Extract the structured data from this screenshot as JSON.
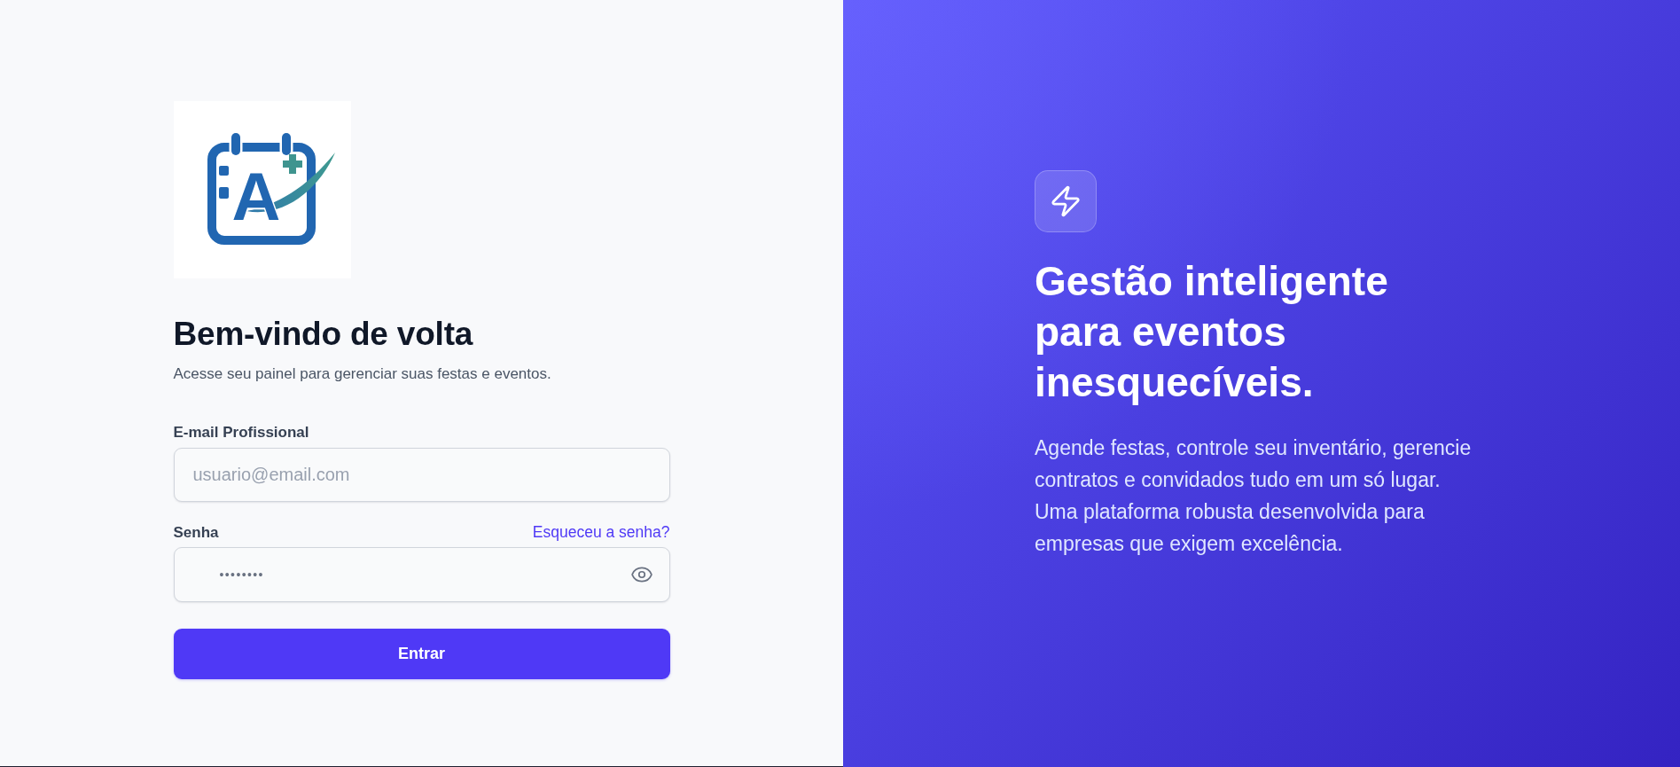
{
  "logo": {
    "letter": "A"
  },
  "login": {
    "heading": "Bem-vindo de volta",
    "subtitle": "Acesse seu painel para gerenciar suas festas e eventos.",
    "email": {
      "label": "E-mail Profissional",
      "placeholder": "usuario@email.com"
    },
    "password": {
      "label": "Senha",
      "forgot_link": "Esqueceu a senha?",
      "value": "••••••••"
    },
    "submit_button": "Entrar"
  },
  "hero": {
    "heading": "Gestão inteligente para eventos inesquecíveis.",
    "description": "Agende festas, controle seu inventário, gerencie contratos e convidados tudo em um só lugar. Uma plataforma robusta desenvolvida para empresas que exigem excelência."
  }
}
